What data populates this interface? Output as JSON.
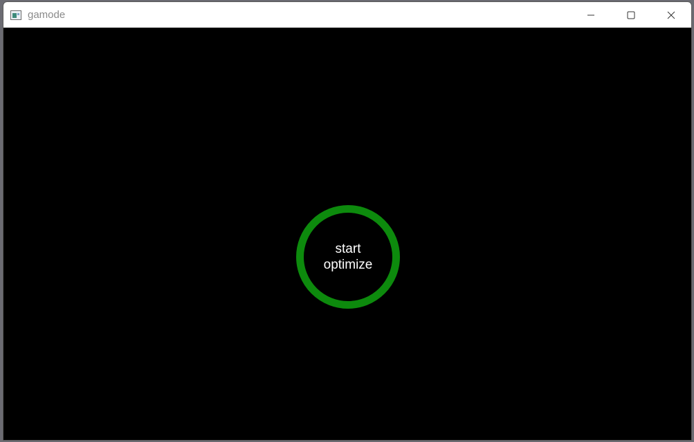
{
  "window": {
    "title": "gamode",
    "accent_color": "#0d8a0d"
  },
  "controls": {
    "minimize_icon": "minimize-icon",
    "maximize_icon": "maximize-icon",
    "close_icon": "close-icon"
  },
  "main": {
    "button_line1": "start",
    "button_line2": "optimize"
  }
}
